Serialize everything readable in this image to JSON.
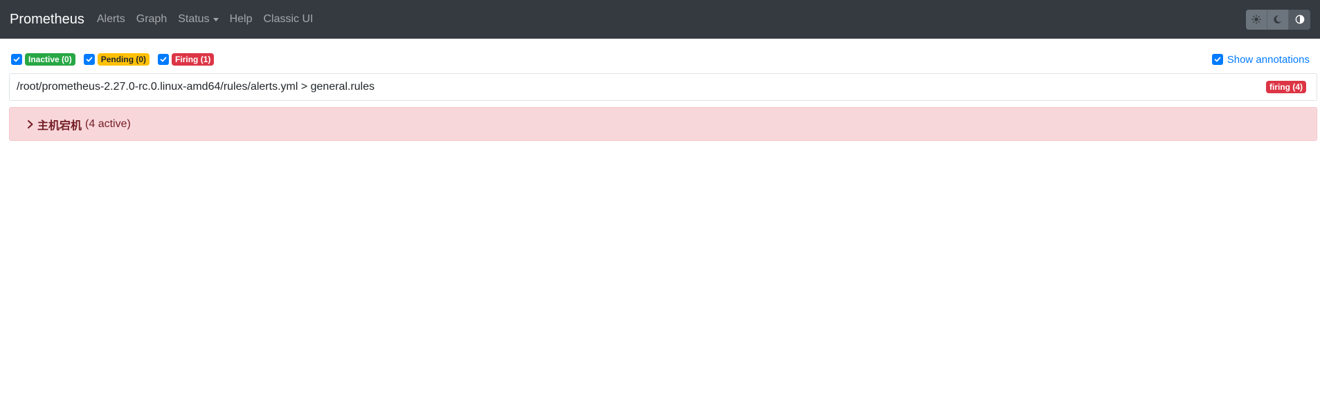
{
  "navbar": {
    "brand": "Prometheus",
    "links": [
      "Alerts",
      "Graph",
      "Status",
      "Help",
      "Classic UI"
    ],
    "theme_buttons": [
      "sun-icon",
      "moon-icon",
      "contrast-icon"
    ]
  },
  "filters": {
    "inactive": "Inactive (0)",
    "pending": "Pending (0)",
    "firing": "Firing (1)",
    "show_annotations": "Show annotations"
  },
  "rule_file": {
    "path": "/root/prometheus-2.27.0-rc.0.linux-amd64/rules/alerts.yml > general.rules",
    "status_badge": "firing (4)"
  },
  "alert_group": {
    "name": "主机宕机",
    "count": "(4 active)"
  },
  "colors": {
    "navbar_bg": "#343a40",
    "success": "#28a745",
    "warning": "#ffc107",
    "danger": "#dc3545",
    "primary": "#007bff",
    "alert_bg": "#f8d7da"
  }
}
